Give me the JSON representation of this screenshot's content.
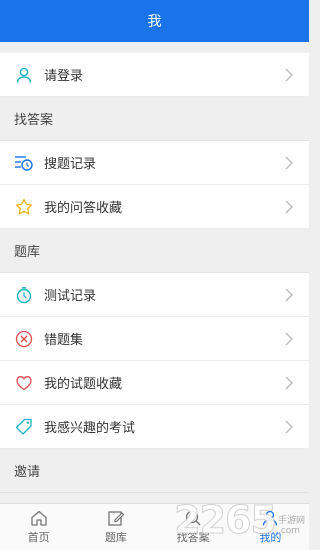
{
  "header": {
    "title": "我"
  },
  "login": {
    "label": "请登录"
  },
  "sections": {
    "find_answers": {
      "title": "找答案",
      "items": [
        {
          "label": "搜题记录",
          "icon": "search-history-icon"
        },
        {
          "label": "我的问答收藏",
          "icon": "star-icon"
        }
      ]
    },
    "question_bank": {
      "title": "题库",
      "items": [
        {
          "label": "测试记录",
          "icon": "timer-icon"
        },
        {
          "label": "错题集",
          "icon": "wrong-x-icon"
        },
        {
          "label": "我的试题收藏",
          "icon": "heart-icon"
        },
        {
          "label": "我感兴趣的考试",
          "icon": "tag-icon"
        }
      ]
    },
    "invite": {
      "title": "邀请"
    }
  },
  "tabbar": {
    "items": [
      {
        "label": "首页",
        "icon": "home-icon"
      },
      {
        "label": "题库",
        "icon": "edit-icon"
      },
      {
        "label": "找答案",
        "icon": "search-icon"
      },
      {
        "label": "我的",
        "icon": "user-icon",
        "active": true
      }
    ]
  },
  "watermark": {
    "number": "2265",
    "line1": "手游网",
    "line2": ".com"
  },
  "colors": {
    "accent": "#1a73e8",
    "icon_teal": "#1bb0c4",
    "icon_red": "#e24b4b",
    "icon_yellow": "#f2b51c"
  }
}
